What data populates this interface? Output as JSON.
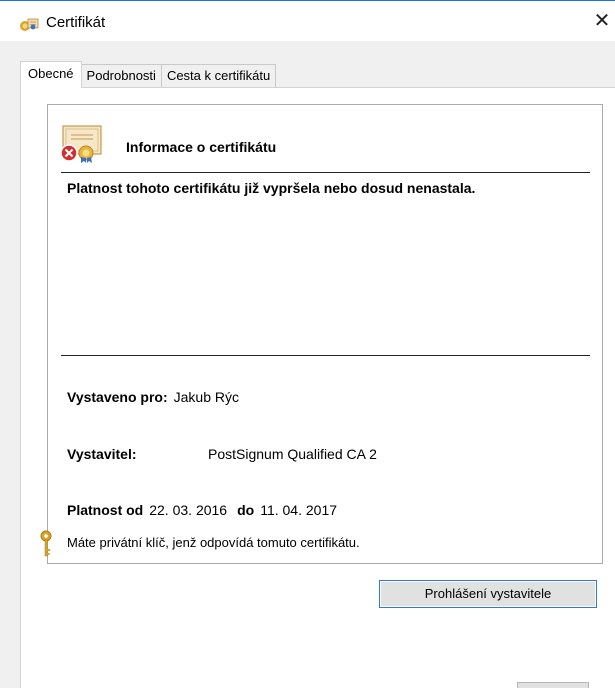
{
  "window": {
    "title": "Certifikát",
    "close_glyph": "✕"
  },
  "tabs": [
    {
      "label": "Obecné",
      "active": true
    },
    {
      "label": "Podrobnosti",
      "active": false
    },
    {
      "label": "Cesta k certifikátu",
      "active": false
    }
  ],
  "info": {
    "title": "Informace o certifikátu",
    "status": "Platnost tohoto certifikátu již vypršela nebo dosud nenastala.",
    "issued_to_label": "Vystaveno pro:",
    "issued_to_value": "Jakub Rýc",
    "issuer_label": "Vystavitel:",
    "issuer_value": "PostSignum Qualified CA 2",
    "valid_from_label": "Platnost od",
    "valid_from_value": "22. 03. 2016",
    "valid_to_label": "do",
    "valid_to_value": "11. 04. 2017",
    "private_key_text": "Máte privátní klíč, jenž odpovídá tomuto certifikátu."
  },
  "buttons": {
    "issuer_statement": "Prohlášení vystavitele"
  },
  "icons": {
    "title": "certificate-icon",
    "cert_status": "certificate-error-icon",
    "key": "key-icon",
    "close": "close-icon"
  },
  "colors": {
    "window_border": "#1a73d9",
    "button_focus": "#2f78d6",
    "error_red": "#d32f2f",
    "key_gold": "#d8a52a"
  }
}
